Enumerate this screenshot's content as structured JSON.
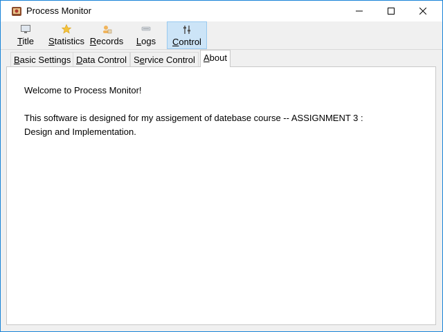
{
  "window": {
    "title": "Process Monitor"
  },
  "toolbar": {
    "items": [
      {
        "label": "Title",
        "icon": "monitor-icon",
        "mnemonic_index": 0
      },
      {
        "label": "Statistics",
        "icon": "star-icon",
        "mnemonic_index": 0
      },
      {
        "label": "Records",
        "icon": "records-icon",
        "mnemonic_index": 0
      },
      {
        "label": "Logs",
        "icon": "logs-icon",
        "mnemonic_index": 0
      },
      {
        "label": "Control",
        "icon": "control-icon",
        "mnemonic_index": 0,
        "active": true
      }
    ]
  },
  "tabs": [
    {
      "label": "Basic Settings",
      "mnemonic_index": 0
    },
    {
      "label": "Data Control",
      "mnemonic_index": 0
    },
    {
      "label": "Service Control",
      "mnemonic_index": 1
    },
    {
      "label": "About",
      "mnemonic_index": 0,
      "active": true
    }
  ],
  "about": {
    "line1": "Welcome to Process Monitor!",
    "line2": "This software is designed for my assigement of datebase course -- ASSIGNMENT 3 :",
    "line3": "Design and Implementation."
  },
  "colors": {
    "accent_border": "#1883d7",
    "active_tool_bg": "#cce4f7",
    "active_tool_border": "#99c9ef",
    "chrome_bg": "#f0f0f0"
  }
}
